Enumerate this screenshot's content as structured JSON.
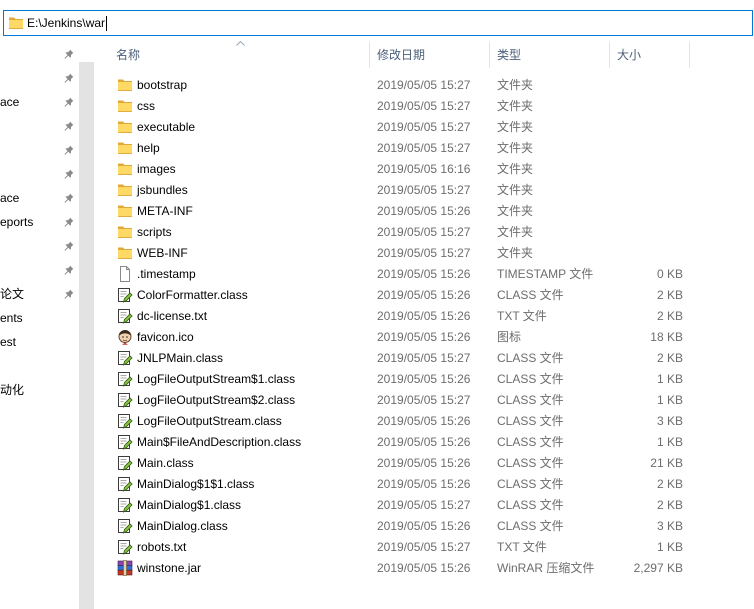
{
  "theme": {
    "accent": "#0078d7",
    "header_text": "#4c607a",
    "detail_text": "#6d6d6d",
    "name_text": "#000000",
    "nav_scrollbar": "#e3e3e3",
    "divider": "#e5e5e5"
  },
  "address_bar": {
    "icon": "folder-icon",
    "path": "E:\\Jenkins\\war"
  },
  "nav_pane": {
    "pin_icon": "pin-icon",
    "items": [
      {
        "pinned": true
      },
      {
        "pinned": true
      },
      {
        "label": "ace",
        "pinned": true
      },
      {
        "pinned": true
      },
      {
        "pinned": true
      },
      {
        "pinned": true
      },
      {
        "label": "ace",
        "pinned": true
      },
      {
        "label": "eports",
        "pinned": true
      },
      {
        "pinned": true
      },
      {
        "pinned": true
      },
      {
        "label": "论文",
        "pinned": true
      },
      {
        "label": "ents",
        "pinned": false
      },
      {
        "label": "est",
        "pinned": false
      },
      {
        "pinned": false
      },
      {
        "label": "动化",
        "pinned": false
      }
    ]
  },
  "columns": {
    "name": {
      "label": "名称",
      "sort_icon": "chevron-up-icon"
    },
    "modified": {
      "label": "修改日期"
    },
    "type": {
      "label": "类型"
    },
    "size": {
      "label": "大小"
    }
  },
  "files": [
    {
      "icon": "folder-icon",
      "name": "bootstrap",
      "modified": "2019/05/05 15:27",
      "type": "文件夹"
    },
    {
      "icon": "folder-icon",
      "name": "css",
      "modified": "2019/05/05 15:27",
      "type": "文件夹"
    },
    {
      "icon": "folder-icon",
      "name": "executable",
      "modified": "2019/05/05 15:27",
      "type": "文件夹"
    },
    {
      "icon": "folder-icon",
      "name": "help",
      "modified": "2019/05/05 15:27",
      "type": "文件夹"
    },
    {
      "icon": "folder-icon",
      "name": "images",
      "modified": "2019/05/05 16:16",
      "type": "文件夹"
    },
    {
      "icon": "folder-icon",
      "name": "jsbundles",
      "modified": "2019/05/05 15:27",
      "type": "文件夹"
    },
    {
      "icon": "folder-icon",
      "name": "META-INF",
      "modified": "2019/05/05 15:26",
      "type": "文件夹"
    },
    {
      "icon": "folder-icon",
      "name": "scripts",
      "modified": "2019/05/05 15:27",
      "type": "文件夹"
    },
    {
      "icon": "folder-icon",
      "name": "WEB-INF",
      "modified": "2019/05/05 15:27",
      "type": "文件夹"
    },
    {
      "icon": "blank-file-icon",
      "name": ".timestamp",
      "modified": "2019/05/05 15:26",
      "type": "TIMESTAMP 文件",
      "size": "0 KB"
    },
    {
      "icon": "text-editor-file-icon",
      "name": "ColorFormatter.class",
      "modified": "2019/05/05 15:26",
      "type": "CLASS 文件",
      "size": "2 KB"
    },
    {
      "icon": "text-editor-file-icon",
      "name": "dc-license.txt",
      "modified": "2019/05/05 15:26",
      "type": "TXT 文件",
      "size": "2 KB"
    },
    {
      "icon": "butler-face-icon",
      "name": "favicon.ico",
      "modified": "2019/05/05 15:26",
      "type": "图标",
      "size": "18 KB"
    },
    {
      "icon": "text-editor-file-icon",
      "name": "JNLPMain.class",
      "modified": "2019/05/05 15:27",
      "type": "CLASS 文件",
      "size": "2 KB"
    },
    {
      "icon": "text-editor-file-icon",
      "name": "LogFileOutputStream$1.class",
      "modified": "2019/05/05 15:26",
      "type": "CLASS 文件",
      "size": "1 KB"
    },
    {
      "icon": "text-editor-file-icon",
      "name": "LogFileOutputStream$2.class",
      "modified": "2019/05/05 15:27",
      "type": "CLASS 文件",
      "size": "1 KB"
    },
    {
      "icon": "text-editor-file-icon",
      "name": "LogFileOutputStream.class",
      "modified": "2019/05/05 15:26",
      "type": "CLASS 文件",
      "size": "3 KB"
    },
    {
      "icon": "text-editor-file-icon",
      "name": "Main$FileAndDescription.class",
      "modified": "2019/05/05 15:26",
      "type": "CLASS 文件",
      "size": "1 KB"
    },
    {
      "icon": "text-editor-file-icon",
      "name": "Main.class",
      "modified": "2019/05/05 15:26",
      "type": "CLASS 文件",
      "size": "21 KB"
    },
    {
      "icon": "text-editor-file-icon",
      "name": "MainDialog$1$1.class",
      "modified": "2019/05/05 15:26",
      "type": "CLASS 文件",
      "size": "2 KB"
    },
    {
      "icon": "text-editor-file-icon",
      "name": "MainDialog$1.class",
      "modified": "2019/05/05 15:27",
      "type": "CLASS 文件",
      "size": "2 KB"
    },
    {
      "icon": "text-editor-file-icon",
      "name": "MainDialog.class",
      "modified": "2019/05/05 15:26",
      "type": "CLASS 文件",
      "size": "3 KB"
    },
    {
      "icon": "text-editor-file-icon",
      "name": "robots.txt",
      "modified": "2019/05/05 15:27",
      "type": "TXT 文件",
      "size": "1 KB"
    },
    {
      "icon": "winrar-archive-icon",
      "name": "winstone.jar",
      "modified": "2019/05/05 15:26",
      "type": "WinRAR 压缩文件",
      "size": "2,297 KB"
    }
  ]
}
